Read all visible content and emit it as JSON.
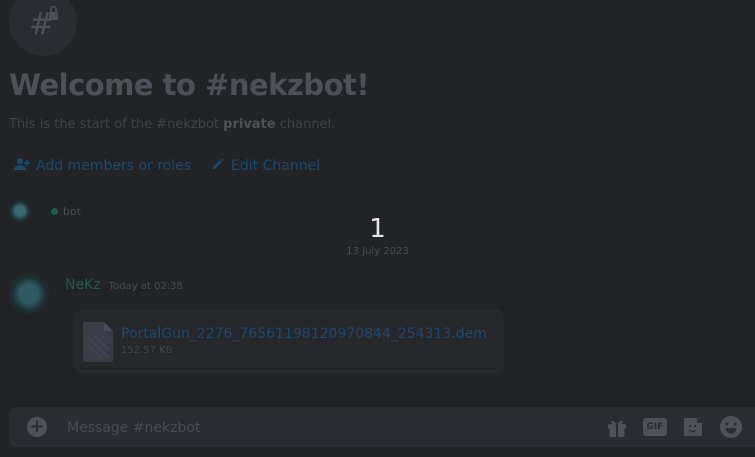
{
  "channel": {
    "welcome_title": "Welcome to #nekzbot!",
    "welcome_prefix": "This is the start of the #nekzbot ",
    "welcome_bold": "private",
    "welcome_suffix": " channel.",
    "actions": {
      "add_members": "Add members or roles",
      "edit_channel": "Edit Channel"
    }
  },
  "bot_row": {
    "tag": "bot"
  },
  "divider": {
    "number": "1",
    "date": "13 July 2023"
  },
  "message": {
    "author": "NeKz",
    "timestamp": "Today at 02:38",
    "attachment": {
      "file_name": "PortalGun_2276_76561198120970844_254313.dem",
      "file_size": "152.57 KB"
    }
  },
  "composer": {
    "placeholder": "Message #nekzbot",
    "gif_label": "GIF"
  },
  "colors": {
    "background": "#222327",
    "link": "#1b4a70",
    "author": "#1d5a55"
  },
  "icons": [
    "locked-channel-icon",
    "person-add-icon",
    "pencil-icon",
    "plus-icon",
    "gift-icon",
    "gif-icon",
    "sticker-icon",
    "emoji-icon"
  ]
}
